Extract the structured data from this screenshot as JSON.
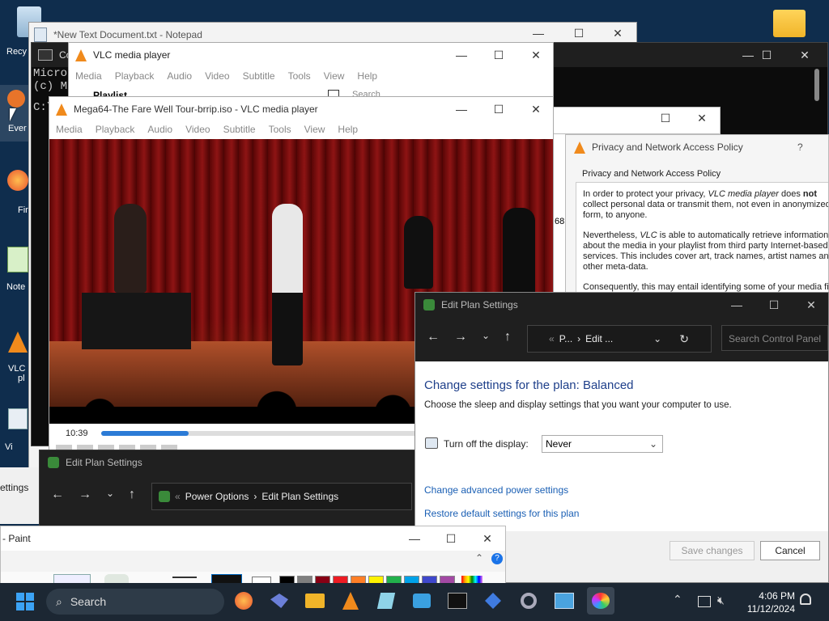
{
  "desktop": {
    "icons": [
      {
        "label": "Recy"
      },
      {
        "label": "Ever"
      },
      {
        "label": "Fir"
      },
      {
        "label": "Note"
      },
      {
        "label": "VLC"
      },
      {
        "label": "pl"
      },
      {
        "label": "Vi"
      }
    ]
  },
  "notepad": {
    "title": "*New Text Document.txt - Notepad"
  },
  "cmd": {
    "title": "Co",
    "line1": "Micros",
    "line2": "(c) Mi",
    "line3": "C:\\"
  },
  "vlc_back": {
    "title": "VLC media player",
    "menu": [
      "Media",
      "Playback",
      "Audio",
      "Video",
      "Subtitle",
      "Tools",
      "View",
      "Help"
    ],
    "playlist_label": "Playlist",
    "search_placeholder": "Search"
  },
  "vlc_front": {
    "title": "Mega64-The Fare Well Tour-brrip.iso - VLC media player",
    "menu": [
      "Media",
      "Playback",
      "Audio",
      "Video",
      "Subtitle",
      "Tools",
      "View",
      "Help"
    ],
    "time": "10:39",
    "progress": 0.2
  },
  "privacy": {
    "title": "Privacy and Network Access Policy",
    "help": "?",
    "heading": "Privacy and Network Access Policy",
    "p1_a": "In order to protect your privacy, ",
    "p1_b": "VLC media player",
    "p1_c": " does ",
    "p1_d": "not",
    "p1_e": " collect personal data or transmit them, not even in anonymized form, to anyone.",
    "p2_a": "Nevertheless, ",
    "p2_b": "VLC",
    "p2_c": " is able to automatically retrieve information about the media in your playlist from third party Internet-based services. This includes cover art, track names, artist names and other meta-data.",
    "p3": "Consequently, this may entail identifying some of your media fil",
    "side_number": "68"
  },
  "edit_plan_back": {
    "title": "Edit Plan Settings",
    "breadcrumb_1": "Power Options",
    "breadcrumb_2": "Edit Plan Settings",
    "side_text": "ettings"
  },
  "edit_plan_front": {
    "title": "Edit Plan Settings",
    "breadcrumb_1": "P...",
    "breadcrumb_2": "Edit ...",
    "search_placeholder": "Search Control Panel",
    "heading": "Change settings for the plan: Balanced",
    "subheading": "Choose the sleep and display settings that you want your computer to use.",
    "display_label": "Turn off the display:",
    "display_value": "Never",
    "advanced_link": "Change advanced power settings",
    "restore_link": "Restore default settings for this plan",
    "save_label": "Save changes",
    "cancel_label": "Cancel"
  },
  "paint": {
    "title": "- Paint",
    "colors": [
      "#000000",
      "#7f7f7f",
      "#880015",
      "#ed1c24",
      "#ff7f27",
      "#fff200",
      "#22b14c",
      "#00a2e8",
      "#3f48cc",
      "#a349a4"
    ]
  },
  "taskbar": {
    "search_label": "Search",
    "time": "4:06 PM",
    "date": "11/12/2024",
    "icons": [
      "firefox-icon",
      "bird-icon",
      "file-explorer-icon",
      "vlc-icon",
      "notepad-icon",
      "virtualbox-icon",
      "terminal-icon",
      "network-icon",
      "settings-icon",
      "control-panel-icon",
      "paint-icon"
    ]
  }
}
